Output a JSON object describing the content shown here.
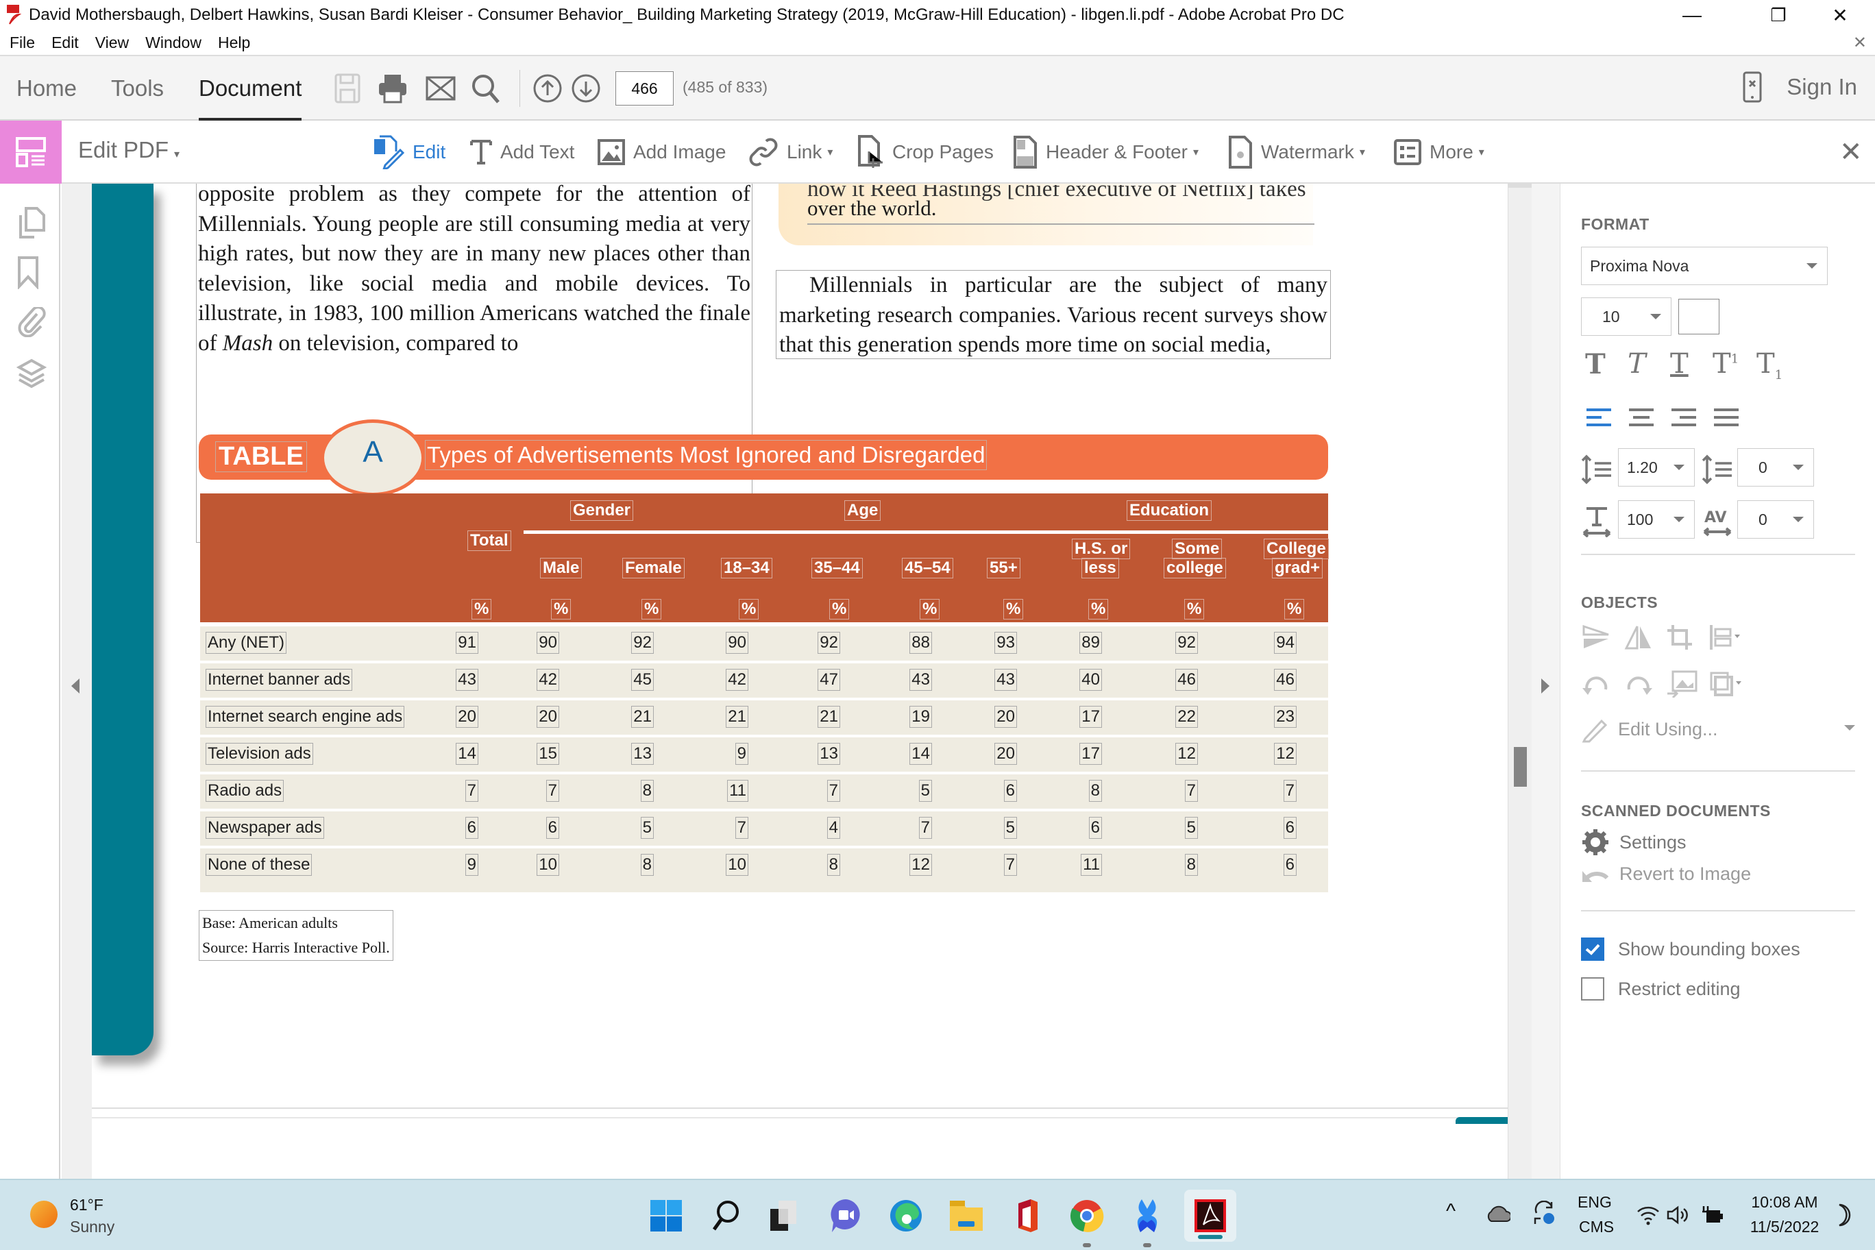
{
  "window": {
    "title": "David Mothersbaugh, Delbert Hawkins, Susan Bardi Kleiser - Consumer Behavior_ Building Marketing Strategy (2019, McGraw-Hill Education) - libgen.li.pdf - Adobe Acrobat Pro DC",
    "controls": {
      "minimize": "—",
      "restore": "❐",
      "close": "✕"
    },
    "doc_close": "✕"
  },
  "menu": [
    "File",
    "Edit",
    "View",
    "Window",
    "Help"
  ],
  "tabs": {
    "items": [
      {
        "label": "Home"
      },
      {
        "label": "Tools"
      },
      {
        "label": "Document",
        "active": true
      }
    ],
    "page_current": "466",
    "page_count": "(485 of 833)",
    "sign_in": "Sign In"
  },
  "edit_toolbar": {
    "title": "Edit PDF",
    "tools": [
      {
        "label": "Edit",
        "icon": "edit-icon",
        "active": true
      },
      {
        "label": "Add Text",
        "icon": "add-text-icon"
      },
      {
        "label": "Add Image",
        "icon": "add-image-icon"
      },
      {
        "label": "Link",
        "icon": "link-icon",
        "dropdown": true
      },
      {
        "label": "Crop Pages",
        "icon": "crop-pages-icon"
      },
      {
        "label": "Header & Footer",
        "icon": "header-footer-icon",
        "dropdown": true
      },
      {
        "label": "Watermark",
        "icon": "watermark-icon",
        "dropdown": true
      },
      {
        "label": "More",
        "icon": "more-icon",
        "dropdown": true
      }
    ],
    "caret": "▾",
    "close": "✕"
  },
  "document": {
    "left_column": "opposite problem as they compete for the attention of Millennials. Young people are still consuming media at very high rates, but now they are in many new places other than television, like social media and mobile devices. To illustrate, in 1983, 100 million Americans watched the finale of",
    "left_italic": "Mash",
    "left_tail": "on television, compared to",
    "pull_quote_cut": "how it Reed Hastings [chief executive of Netflix] takes",
    "pull_quote": "over the world.",
    "right_column": "Millennials in particular are the subject of many marketing research companies. Various recent surveys show that this generation spends more time on social media,",
    "table": {
      "label": "TABLE",
      "letter": "A",
      "title": "Types of Advertisements Most Ignored and Disregarded",
      "groups": {
        "gender": "Gender",
        "age": "Age",
        "education": "Education"
      },
      "total_header": "Total",
      "columns": [
        {
          "l1": "Male"
        },
        {
          "l1": "Female"
        },
        {
          "l1": "18–34"
        },
        {
          "l1": "35–44"
        },
        {
          "l1": "45–54"
        },
        {
          "l1": "55+"
        },
        {
          "l0": "H.S. or",
          "l1": "less"
        },
        {
          "l0": "Some",
          "l1": "college"
        },
        {
          "l0": "College",
          "l1": "grad+"
        }
      ],
      "unit": "%",
      "rows": [
        {
          "label": "Any (NET)",
          "values": [
            "91",
            "90",
            "92",
            "90",
            "92",
            "88",
            "93",
            "89",
            "92",
            "94"
          ]
        },
        {
          "label": "Internet banner ads",
          "values": [
            "43",
            "42",
            "45",
            "42",
            "47",
            "43",
            "43",
            "40",
            "46",
            "46"
          ]
        },
        {
          "label": "Internet search engine ads",
          "values": [
            "20",
            "20",
            "21",
            "21",
            "21",
            "19",
            "20",
            "17",
            "22",
            "23"
          ]
        },
        {
          "label": "Television ads",
          "values": [
            "14",
            "15",
            "13",
            "9",
            "13",
            "14",
            "20",
            "17",
            "12",
            "12"
          ]
        },
        {
          "label": "Radio ads",
          "values": [
            "7",
            "7",
            "8",
            "11",
            "7",
            "5",
            "6",
            "8",
            "7",
            "7"
          ]
        },
        {
          "label": "Newspaper ads",
          "values": [
            "6",
            "6",
            "5",
            "7",
            "4",
            "7",
            "5",
            "6",
            "5",
            "6"
          ]
        },
        {
          "label": "None of these",
          "values": [
            "9",
            "10",
            "8",
            "10",
            "8",
            "12",
            "7",
            "11",
            "8",
            "6"
          ]
        }
      ],
      "base": "Base: American adults",
      "source": "Source: Harris Interactive Poll."
    }
  },
  "right_panel": {
    "format_header": "FORMAT",
    "font": "Proxima Nova",
    "font_size": "10",
    "line_spacing": "1.20",
    "paragraph_spacing": "0",
    "horizontal_scale": "100",
    "char_spacing": "0",
    "objects_header": "OBJECTS",
    "edit_using": "Edit Using...",
    "scanned_header": "SCANNED DOCUMENTS",
    "settings": "Settings",
    "revert": "Revert to Image",
    "show_bounding_boxes": {
      "label": "Show bounding boxes",
      "checked": true
    },
    "restrict_editing": {
      "label": "Restrict editing",
      "checked": false
    }
  },
  "taskbar": {
    "weather_temp": "61°F",
    "weather_desc": "Sunny",
    "lang1": "ENG",
    "lang2": "CMS",
    "time": "10:08 AM",
    "date": "11/5/2022"
  },
  "colors": {
    "accent_blue": "#2d7dd2",
    "edit_pink": "#ea88dc",
    "table_orange": "#f27145",
    "table_header": "#bf5733",
    "row_bg": "#efece1",
    "teal": "#017b8f"
  }
}
